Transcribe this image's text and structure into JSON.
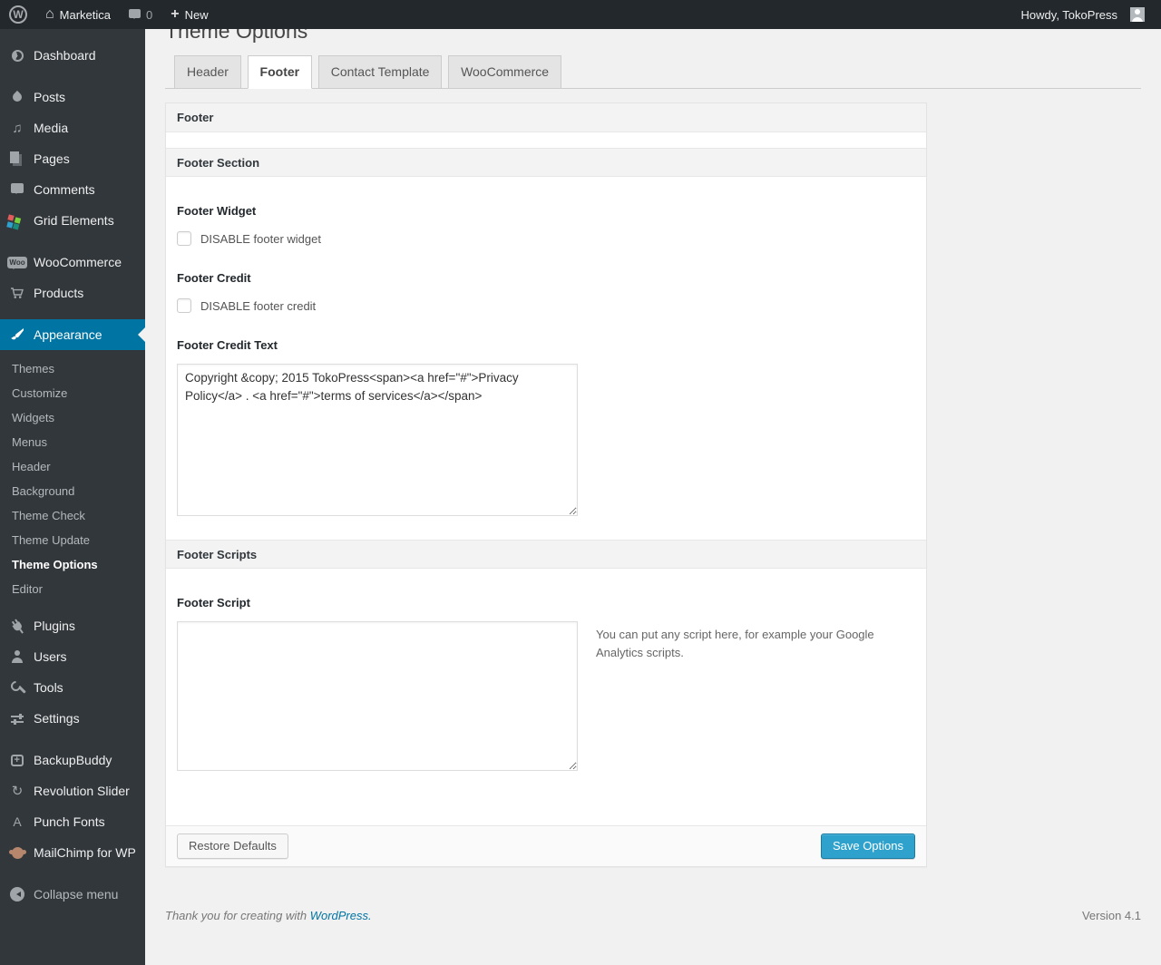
{
  "admin_bar": {
    "wp_logo": "W",
    "site_name": "Marketica",
    "comment_count": "0",
    "new_label": "New",
    "howdy": "Howdy, TokoPress"
  },
  "sidebar": {
    "items": [
      {
        "label": "Dashboard"
      },
      {
        "label": "Posts"
      },
      {
        "label": "Media"
      },
      {
        "label": "Pages"
      },
      {
        "label": "Comments"
      },
      {
        "label": "Grid Elements"
      },
      {
        "label": "WooCommerce"
      },
      {
        "label": "Products"
      },
      {
        "label": "Appearance",
        "active": true
      },
      {
        "label": "Plugins"
      },
      {
        "label": "Users"
      },
      {
        "label": "Tools"
      },
      {
        "label": "Settings"
      },
      {
        "label": "BackupBuddy"
      },
      {
        "label": "Revolution Slider"
      },
      {
        "label": "Punch Fonts"
      },
      {
        "label": "MailChimp for WP"
      },
      {
        "label": "Collapse menu"
      }
    ],
    "woo_badge": "Woo",
    "punch_fonts_glyph": "A",
    "revolution_glyph": "↻",
    "media_glyph": "♫",
    "appearance_submenu": {
      "current": "Theme Options",
      "items": [
        {
          "label": "Themes"
        },
        {
          "label": "Customize"
        },
        {
          "label": "Widgets"
        },
        {
          "label": "Menus"
        },
        {
          "label": "Header"
        },
        {
          "label": "Background"
        },
        {
          "label": "Theme Check"
        },
        {
          "label": "Theme Update"
        },
        {
          "label": "Theme Options",
          "current": true
        },
        {
          "label": "Editor"
        }
      ]
    }
  },
  "main": {
    "page_title": "Theme Options",
    "tabs": [
      {
        "label": "Header",
        "active": false
      },
      {
        "label": "Footer",
        "active": true
      },
      {
        "label": "Contact Template",
        "active": false
      },
      {
        "label": "WooCommerce",
        "active": false
      }
    ],
    "panel": {
      "header": "Footer",
      "footer_section": {
        "title": "Footer Section",
        "footer_widget_label": "Footer Widget",
        "footer_widget_checkbox_label": "DISABLE footer widget",
        "footer_widget_checked": false,
        "footer_credit_label": "Footer Credit",
        "footer_credit_checkbox_label": "DISABLE footer credit",
        "footer_credit_checked": false,
        "footer_credit_text_label": "Footer Credit Text",
        "footer_credit_text_value": "Copyright &copy; 2015 TokoPress<span><a href=\"#\">Privacy Policy</a> . <a href=\"#\">terms of services</a></span>"
      },
      "footer_scripts": {
        "title": "Footer Scripts",
        "footer_script_label": "Footer Script",
        "footer_script_value": "",
        "help_text": "You can put any script here, for example your Google Analytics scripts."
      },
      "actions": {
        "restore_label": "Restore Defaults",
        "save_label": "Save Options"
      }
    }
  },
  "page_footer": {
    "thanks_text": "Thank you for creating with ",
    "wordpress_link": "WordPress.",
    "version": "Version 4.1"
  },
  "colors": {
    "admin_bar_bg": "#23282d",
    "sidebar_bg": "#32373c",
    "menu_highlight": "#0074a2",
    "primary_button": "#2ea2cc",
    "link": "#0074a2",
    "page_bg": "#f1f1f1"
  }
}
